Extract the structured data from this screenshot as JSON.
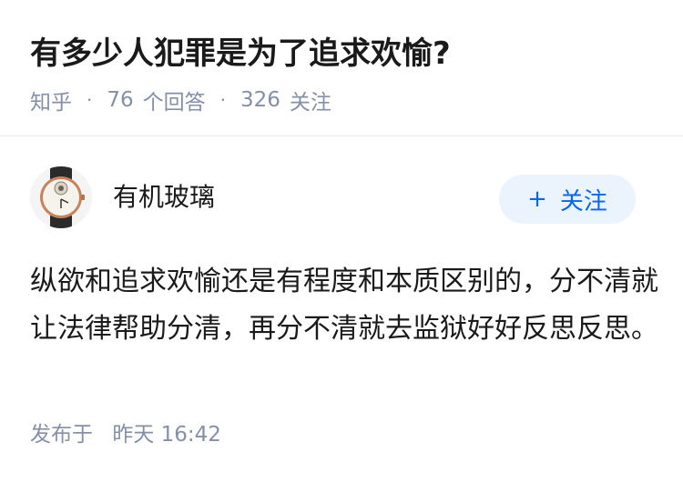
{
  "question": {
    "title": "有多少人犯罪是为了追求欢愉?",
    "source": "知乎",
    "separator": "·",
    "answer_count": "76",
    "answer_label": "个回答",
    "follower_count": "326",
    "follower_label": "关注"
  },
  "answer": {
    "author": {
      "name": "有机玻璃",
      "avatar_icon": "watch-avatar-icon"
    },
    "follow_button": {
      "icon": "+",
      "label": "关注"
    },
    "content": "纵欲和追求欢愉还是有程度和本质区别的，分不清就让法律帮助分清，再分不清就去监狱好好反思反思。",
    "published_label": "发布于",
    "published_time": "昨天 16:42"
  },
  "colors": {
    "title": "#1a1a1a",
    "meta": "#8590a6",
    "accent": "#0066ff",
    "follow_bg": "#ebf4fd",
    "divider": "#ebebeb"
  }
}
